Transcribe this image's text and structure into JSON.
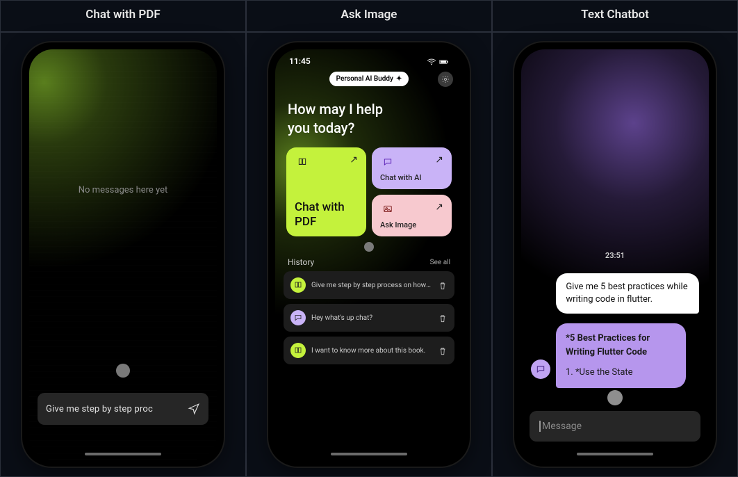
{
  "columns": {
    "c1": "Chat with PDF",
    "c2": "Ask Image",
    "c3": "Text Chatbot"
  },
  "screen1": {
    "empty_message": "No messages here yet",
    "input_value": "Give me step by step proc"
  },
  "screen2": {
    "status_time": "11:45",
    "pill_label": "Personal AI Buddy",
    "headline_line1": "How may I help",
    "headline_line2": "you today?",
    "card_pdf": "Chat with PDF",
    "card_ai": "Chat with AI",
    "card_img": "Ask Image",
    "history_label": "History",
    "see_all": "See all",
    "history_items": [
      "Give me step by step process on how t…",
      "Hey what's up chat?",
      "I want to know more about this book."
    ]
  },
  "screen3": {
    "timestamp": "23:51",
    "user_msg": "Give me 5 best practices while writing code in flutter.",
    "bot_title": "*5 Best Practices for Writing Flutter Code",
    "bot_line1": "1. *Use the State",
    "placeholder": "Message"
  }
}
